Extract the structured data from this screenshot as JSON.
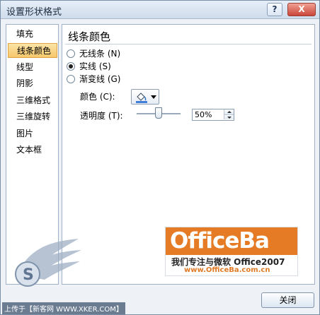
{
  "window": {
    "title": "设置形状格式",
    "help_button": "?",
    "close_button": "X"
  },
  "sidebar": {
    "items": [
      {
        "label": "填充"
      },
      {
        "label": "线条颜色",
        "selected": true
      },
      {
        "label": "线型"
      },
      {
        "label": "阴影"
      },
      {
        "label": "三维格式"
      },
      {
        "label": "三维旋转"
      },
      {
        "label": "图片"
      },
      {
        "label": "文本框"
      }
    ]
  },
  "panel": {
    "heading": "线条颜色",
    "options": [
      {
        "label": "无线条 (N)",
        "selected": false
      },
      {
        "label": "实线 (S)",
        "selected": true
      },
      {
        "label": "渐变线 (G)",
        "selected": false
      }
    ],
    "color_label": "颜色 (C):",
    "transparency_label": "透明度 (T):",
    "transparency_value": "50%",
    "transparency_fraction": 0.5
  },
  "watermark": {
    "brand": "OfficeBa",
    "slogan": "我们专注与微软 Office2007",
    "url": "www.OfficeBa.com.cn",
    "bottom_text": "上传于【新客网 WWW.XKER.COM】"
  },
  "footer": {
    "close_label": "关闭"
  },
  "colors": {
    "selected_item_bg": "#f6c86b",
    "brand_orange": "#e57b25"
  }
}
